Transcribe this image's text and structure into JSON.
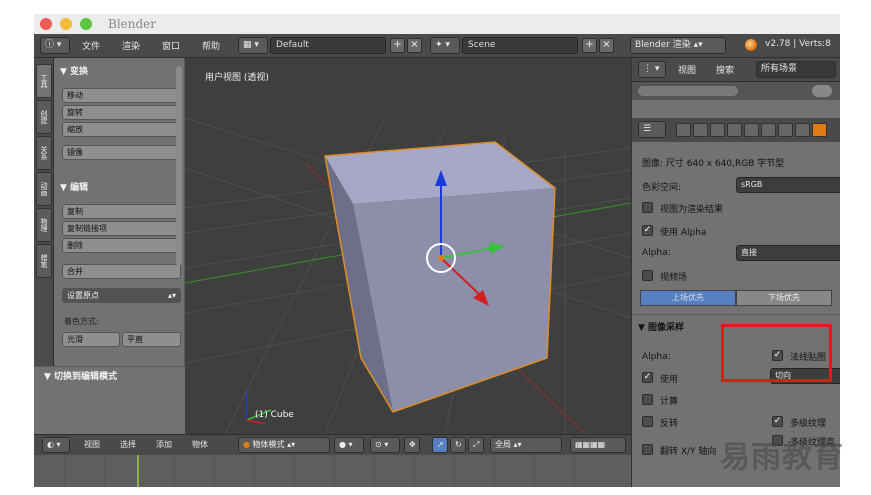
{
  "window": {
    "title": "Blender"
  },
  "header": {
    "menus": [
      "文件",
      "渲染",
      "窗口",
      "帮助"
    ],
    "layout_field": "Default",
    "scene_field": "Scene",
    "engine_select": "Blender 渲染",
    "version": "v2.78 | Verts:8"
  },
  "left_tabs": [
    "工具",
    "创建",
    "关系",
    "动画",
    "物理",
    "蜡笔"
  ],
  "tool_panel": {
    "transform_header": "▼ 变换",
    "transform_buttons": [
      "移动",
      "旋转",
      "缩放",
      "镜像"
    ],
    "edit_header": "▼ 编辑",
    "edit_buttons": [
      "复制",
      "复制链接项",
      "删除",
      "合并"
    ],
    "set_origin": "设置原点",
    "shading_label": "着色方式:",
    "shading_buttons": [
      "光滑",
      "平直"
    ],
    "edit_mode_toggle": "▼ 切换到编辑模式"
  },
  "viewport": {
    "title": "用户视图 (透视)",
    "object_label": "(1) Cube"
  },
  "bottom_header": {
    "menus": [
      "视图",
      "选择",
      "添加",
      "物体"
    ],
    "mode_select": "物体模式",
    "global_select": "全局"
  },
  "right_panel": {
    "header": {
      "view": "视图",
      "search": "搜索",
      "scenes": "所有场景"
    },
    "image_info": "图像: 尺寸 640 x 640,RGB 字节型",
    "color_space_label": "色彩空间:",
    "color_space_value": "sRGB",
    "view_as_render": "视图为渲染结果",
    "use_alpha": "使用 Alpha",
    "alpha_label": "Alpha:",
    "alpha_value": "直接",
    "fields": "视频场",
    "upper_first": "上场优先",
    "lower_first": "下场优先",
    "image_sampling_header": "▼ 图像采样",
    "sampling_alpha_label": "Alpha:",
    "use": "使用",
    "normal_map": "法线贴图",
    "tangent_select": "切向",
    "calculate": "计算",
    "flip": "反转",
    "mipmap": "多级纹理",
    "flip_xy": "翻转 X/Y 轴向",
    "mipmap_high": "多级纹理高..."
  },
  "watermark": {
    "text": "易雨教育"
  },
  "colors": {
    "accent_orange": "#e07b16",
    "highlight_red": "#e21919",
    "toggle_blue": "#5680c2",
    "axis_x": "#d12020",
    "axis_y": "#3dbd3d",
    "axis_z": "#1530d6"
  }
}
